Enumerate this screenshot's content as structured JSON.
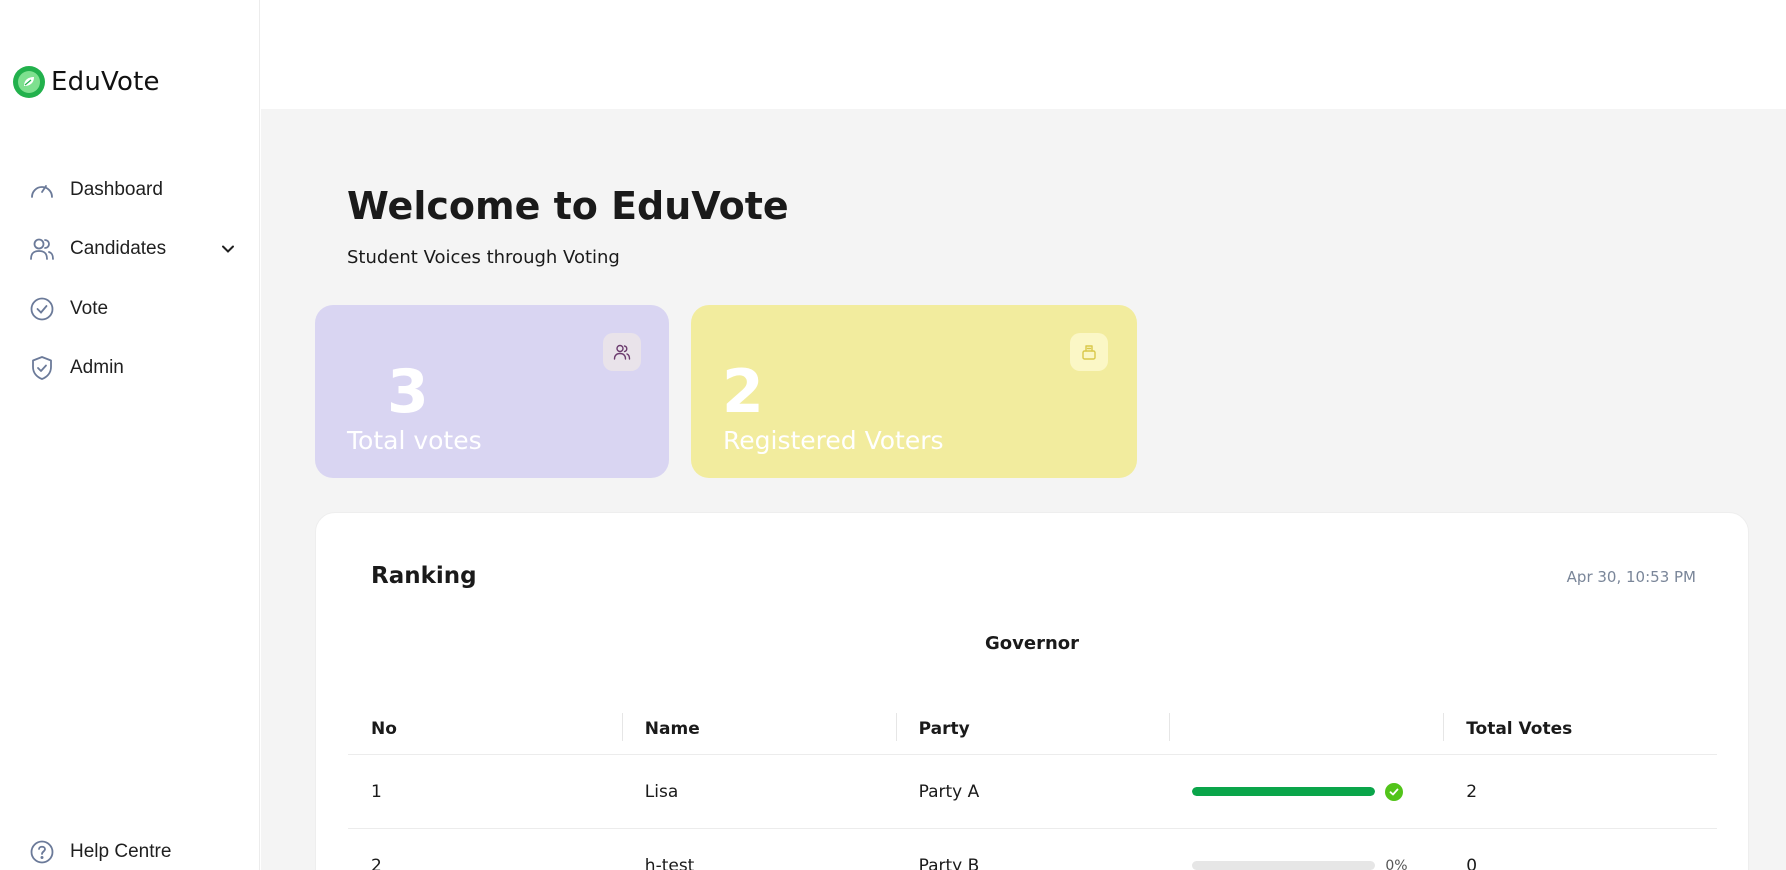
{
  "brand": {
    "name": "EduVote",
    "logo_icon": "leaf-logo-icon",
    "accent": "#22b14c"
  },
  "sidebar": {
    "items": [
      {
        "label": "Dashboard",
        "icon": "speedometer-icon"
      },
      {
        "label": "Candidates",
        "icon": "users-icon",
        "expandable": true
      },
      {
        "label": "Vote",
        "icon": "check-circle-icon"
      },
      {
        "label": "Admin",
        "icon": "shield-check-icon"
      }
    ],
    "help": {
      "label": "Help Centre",
      "icon": "question-circle-icon"
    }
  },
  "main": {
    "title": "Welcome to EduVote",
    "subtitle": "Student Voices through Voting",
    "stats": [
      {
        "value": "3",
        "label": "Total votes",
        "icon": "users-icon",
        "color": "#d9d5f2"
      },
      {
        "value": "2",
        "label": "Registered Voters",
        "icon": "ballot-box-icon",
        "color": "#f2ec9e"
      }
    ],
    "ranking": {
      "title": "Ranking",
      "timestamp": "Apr 30, 10:53 PM",
      "position": "Governor",
      "columns": [
        "No",
        "Name",
        "Party",
        "",
        "Total Votes"
      ],
      "rows": [
        {
          "no": "1",
          "name": "Lisa",
          "party": "Party A",
          "progress": 100,
          "pct_label": "",
          "winner": true,
          "votes": "2"
        },
        {
          "no": "2",
          "name": "h-test",
          "party": "Party B",
          "progress": 0,
          "pct_label": "0%",
          "winner": false,
          "votes": "0"
        }
      ]
    }
  }
}
